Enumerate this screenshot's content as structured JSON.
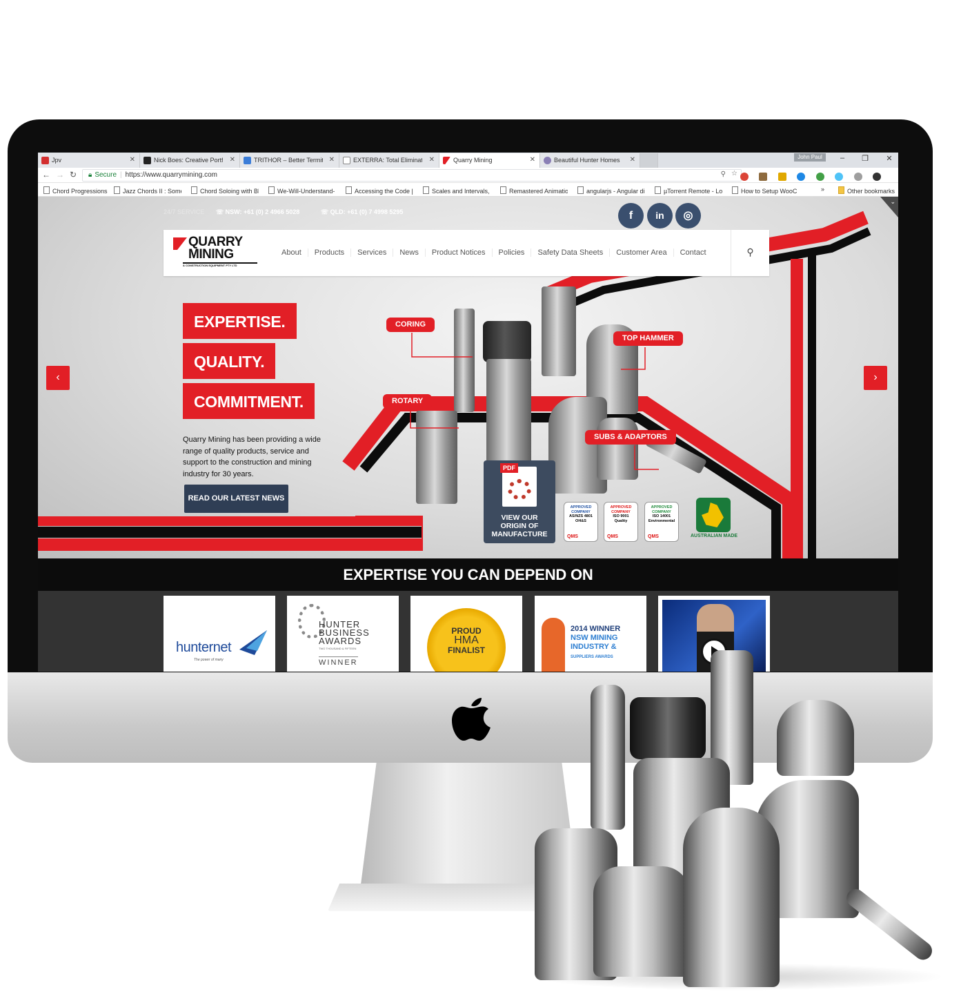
{
  "browser": {
    "tabs": [
      {
        "label": "Jpv",
        "icon": "angular-icon"
      },
      {
        "label": "Nick Boes: Creative Portf",
        "icon": "n-icon"
      },
      {
        "label": "TRITHOR – Better Termit",
        "icon": "trithor-icon"
      },
      {
        "label": "EXTERRA: Total Eliminatio",
        "icon": "page-icon"
      },
      {
        "label": "Quarry Mining",
        "icon": "quarry-mining-icon"
      },
      {
        "label": "Beautiful Hunter Homes",
        "icon": "globe-icon"
      }
    ],
    "user": "John Paul",
    "secure_label": "Secure",
    "url": "https://www.quarrymining.com",
    "bookmarks": [
      "Chord Progressions",
      "Jazz Chords II : Some",
      "Chord Soloing with Bl",
      "We-Will-Understand-",
      "Accessing the Code |",
      "Scales and Intervals, P",
      "Remastered Animatio",
      "angularjs - Angular di",
      "µTorrent Remote - Lo",
      "How to Setup WooCo"
    ],
    "bookmarks_overflow": "»",
    "other_bookmarks": "Other bookmarks"
  },
  "site": {
    "topbar": {
      "service": "24/7 SERVICE",
      "nsw": "NSW: +61 (0) 2 4966 5028",
      "qld": "QLD: +61 (0) 7 4998 5295"
    },
    "social": [
      "f",
      "in",
      "◎"
    ],
    "logo": {
      "line1": "QUARRY",
      "line2": "MINING",
      "sub": "& CONSTRUCTION EQUIPMENT PTY LTD"
    },
    "menu": [
      "About",
      "Products",
      "Services",
      "News",
      "Product Notices",
      "Policies",
      "Safety Data Sheets",
      "Customer Area",
      "Contact"
    ],
    "hero": {
      "tags": [
        "EXPERTISE.",
        "QUALITY.",
        "COMMITMENT."
      ],
      "intro": "Quarry Mining has been providing a wide range of quality products, service and support to the construction and mining industry for 30 years.",
      "button": "READ OUR LATEST NEWS",
      "callouts": [
        "CORING",
        "TOP HAMMER",
        "ROTARY",
        "SUBS & ADAPTORS"
      ],
      "origin": {
        "pdf": "PDF",
        "line1": "VIEW OUR",
        "line2": "ORIGIN OF",
        "line3": "MANUFACTURE"
      },
      "badges": [
        {
          "l1": "APPROVED",
          "l2": "COMPANY",
          "l3": "AS/NZS 4801",
          "l4": "OH&S",
          "qms": "QMS"
        },
        {
          "l1": "APPROVED",
          "l2": "COMPANY",
          "l3": "ISO 9001",
          "l4": "Quality",
          "qms": "QMS"
        },
        {
          "l1": "APPROVED",
          "l2": "COMPANY",
          "l3": "ISO 14001",
          "l4": "Environmental",
          "qms": "QMS"
        }
      ],
      "aus_made": "AUSTRALIAN MADE"
    },
    "band": "EXPERTISE YOU CAN DEPEND ON",
    "cards": {
      "hunternet": {
        "brand": "hunternet",
        "tagline": "The power of many"
      },
      "hunter_awards": {
        "l1": "HUNTER",
        "l2": "BUSINESS",
        "l3": "AWARDS",
        "l4": "TWO THOUSAND & FIFTEEN",
        "l5": "WINNER"
      },
      "hma": {
        "l1": "PROUD",
        "l2": "HMA",
        "l3": "FINALIST"
      },
      "mining": {
        "l1": "2014 WINNER",
        "l2": "NSW MINING",
        "l3": "INDUSTRY &",
        "l4": "SUPPLIERS AWARDS"
      }
    }
  },
  "colors": {
    "brand_red": "#e21f26",
    "navy": "#2f3e55",
    "black": "#0c0c0c"
  }
}
